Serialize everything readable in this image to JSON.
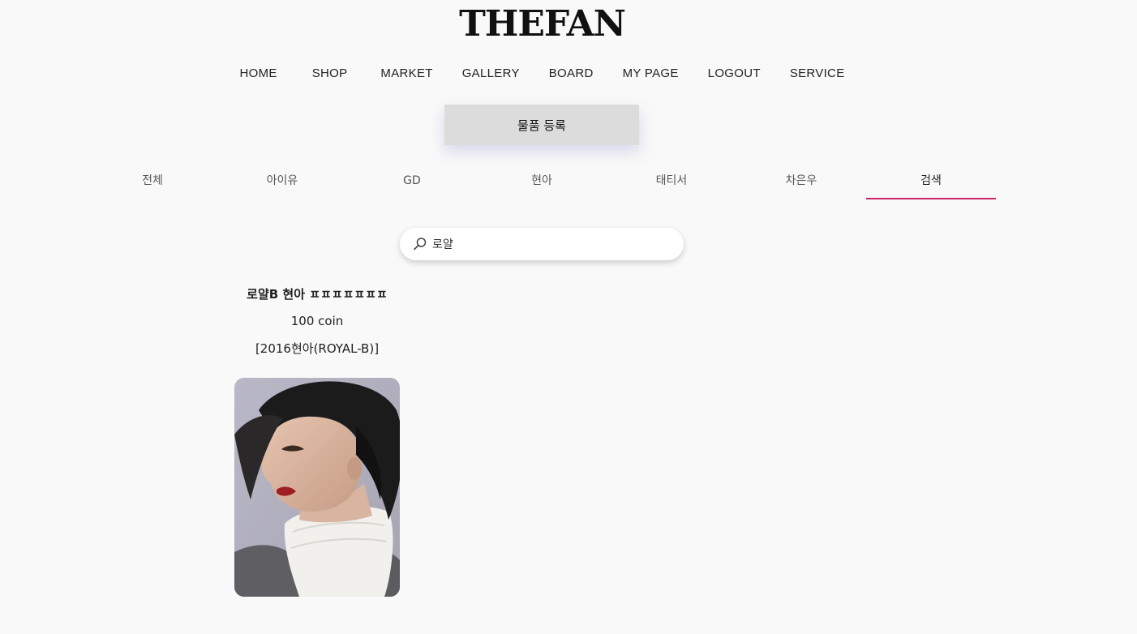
{
  "brand": {
    "logo_text": "THEFAN"
  },
  "nav": {
    "items": [
      "HOME",
      "SHOP",
      "MARKET",
      "GALLERY",
      "BOARD",
      "MY PAGE",
      "LOGOUT",
      "SERVICE"
    ]
  },
  "register_button": {
    "label": "물품 등록"
  },
  "tabs": {
    "items": [
      "전체",
      "아이유",
      "GD",
      "현아",
      "태티서",
      "차은우",
      "검색"
    ],
    "active": "검색"
  },
  "search": {
    "value": "로얄",
    "icon": "search-icon"
  },
  "results": [
    {
      "title": "로얄B 현아 ㅍㅍㅍㅍㅍㅍㅍ",
      "price": "100 coin",
      "tag": "[2016현아(ROYAL-B)]"
    }
  ],
  "colors": {
    "accent": "#c8246a",
    "background": "#f9f9f9"
  }
}
